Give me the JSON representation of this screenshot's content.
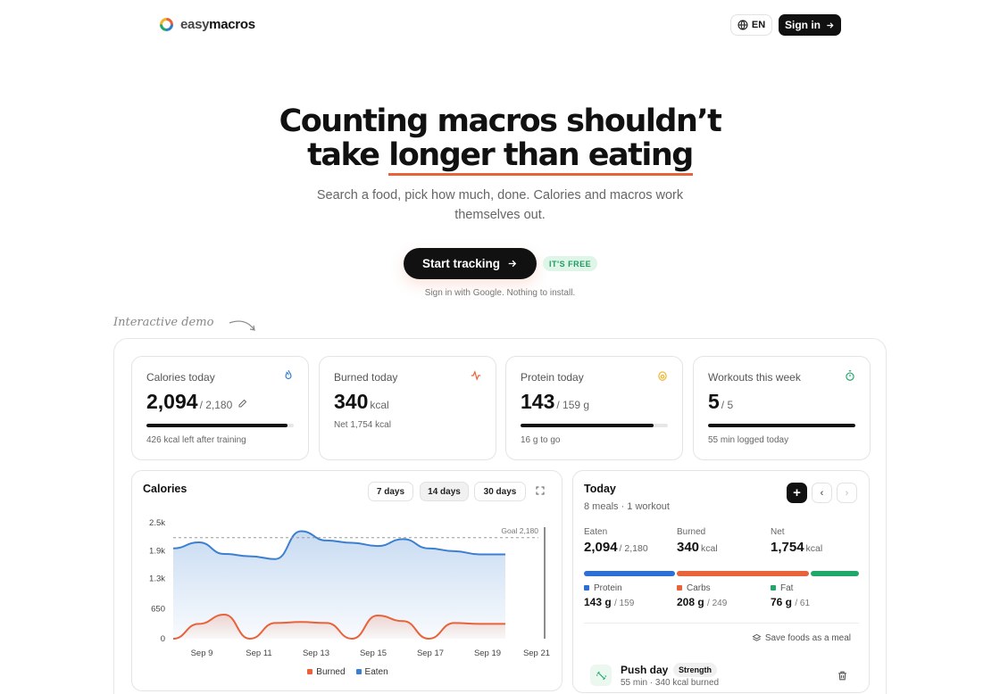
{
  "header": {
    "brand_light": "easy",
    "brand_bold": "macros",
    "lang": "EN",
    "signin": "Sign in"
  },
  "hero": {
    "title_line1": "Counting macros shouldn’t",
    "title_line2_pre": "take ",
    "title_line2_ul": "longer than eating",
    "subtitle": "Search a food, pick how much, done. Calories and macros work themselves out.",
    "cta": "Start tracking",
    "badge": "IT'S FREE",
    "note": "Sign in with Google. Nothing to install.",
    "demo_label": "Interactive demo"
  },
  "stats": [
    {
      "label": "Calories today",
      "value": "2,094",
      "unit": "/ 2,180",
      "sub": "426 kcal left after training",
      "progress": 0.96,
      "icon": "flame-icon",
      "icon_color": "#2d7dd2"
    },
    {
      "label": "Burned today",
      "value": "340",
      "unit": "kcal",
      "sub": "Net 1,754 kcal",
      "icon": "activity-icon",
      "icon_color": "#e8623a"
    },
    {
      "label": "Protein today",
      "value": "143",
      "unit": "/ 159 g",
      "sub": "16 g to go",
      "progress": 0.9,
      "icon": "egg-icon",
      "icon_color": "#f0b429"
    },
    {
      "label": "Workouts this week",
      "value": "5",
      "unit": "/ 5",
      "sub": "55 min logged today",
      "progress": 1.0,
      "icon": "timer-icon",
      "icon_color": "#20a86b"
    }
  ],
  "chart_card": {
    "title": "Calories",
    "ranges": [
      "7 days",
      "14 days",
      "30 days"
    ],
    "active_range": "14 days"
  },
  "chart_data": {
    "type": "area",
    "yticks": [
      "2.5k",
      "1.9k",
      "1.3k",
      "650",
      "0"
    ],
    "ylim": [
      0,
      2600
    ],
    "xticks": [
      "Sep 9",
      "Sep 11",
      "Sep 13",
      "Sep 15",
      "Sep 17",
      "Sep 19",
      "Sep 21"
    ],
    "goal": 2180,
    "goal_label": "Goal 2,180",
    "x_index": [
      0,
      1,
      2,
      3,
      4,
      5,
      6,
      7,
      8,
      9,
      10,
      11,
      12,
      13
    ],
    "series": [
      {
        "name": "Eaten",
        "color": "#3b7fd0",
        "values": [
          1950,
          2080,
          1830,
          1780,
          1720,
          2320,
          2120,
          2070,
          2000,
          2150,
          1950,
          1890,
          1820,
          1820
        ]
      },
      {
        "name": "Burned",
        "color": "#e8623a",
        "values": [
          0,
          320,
          520,
          0,
          340,
          360,
          340,
          0,
          500,
          380,
          0,
          340,
          320,
          320
        ]
      }
    ]
  },
  "today": {
    "title": "Today",
    "meta": "8 meals · 1 workout",
    "eaten_label": "Eaten",
    "eaten": "2,094",
    "eaten_of": "/ 2,180",
    "burned_label": "Burned",
    "burned": "340",
    "burned_unit": "kcal",
    "net_label": "Net",
    "net": "1,754",
    "net_unit": "kcal",
    "macros": [
      {
        "name": "Protein",
        "value": "143 g",
        "target": "/ 159",
        "color": "#2d6fd2",
        "grams": 143
      },
      {
        "name": "Carbs",
        "value": "208 g",
        "target": "/ 249",
        "color": "#e8623a",
        "grams": 208
      },
      {
        "name": "Fat",
        "value": "76 g",
        "target": "/ 61",
        "color": "#20a86b",
        "grams": 76
      }
    ],
    "save_meal": "Save foods as a meal",
    "entry_name": "Push day",
    "entry_tag": "Strength",
    "entry_sub": "55 min · 340 kcal burned"
  }
}
